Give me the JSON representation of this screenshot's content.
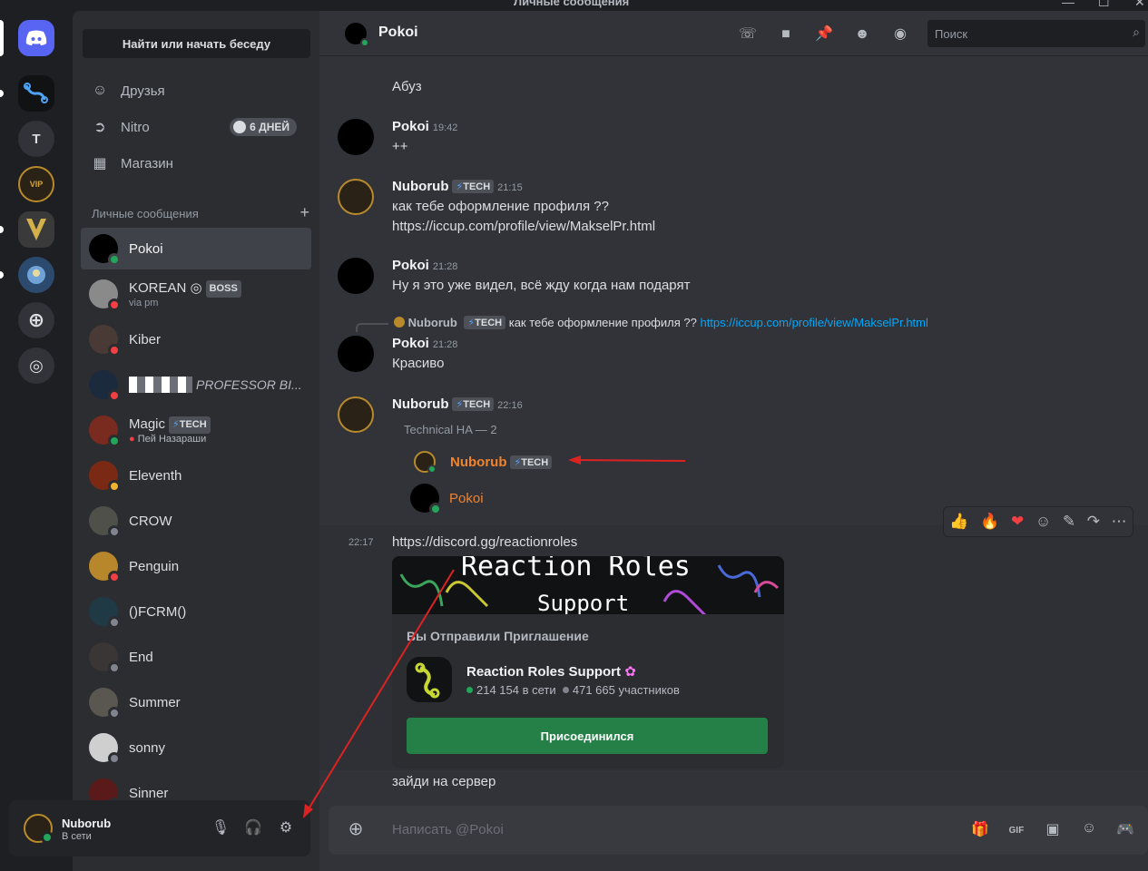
{
  "window": {
    "title": "Личные сообщения"
  },
  "rail": {
    "servers": [
      "T"
    ]
  },
  "sidebar": {
    "search_label": "Найти или начать беседу",
    "nav": [
      {
        "label": "Друзья",
        "icon": "friends-icon"
      },
      {
        "label": "Nitro",
        "icon": "nitro-icon",
        "badge": "6 ДНЕЙ"
      },
      {
        "label": "Магазин",
        "icon": "shop-icon"
      }
    ],
    "dm_header": "Личные сообщения",
    "dms": [
      {
        "name": "Pokoi",
        "status": "online",
        "selected": true
      },
      {
        "name": "KOREAN ◎",
        "tag": "BOSS",
        "sub": "via pm",
        "status": "dnd"
      },
      {
        "name": "Kiber",
        "status": "dnd"
      },
      {
        "name": "PROFESSOR BI...",
        "status": "dnd"
      },
      {
        "name": "Magic",
        "tag": "TECH",
        "sub": "Пей Назараши",
        "status": "online"
      },
      {
        "name": "Eleventh",
        "status": "idle"
      },
      {
        "name": "CROW",
        "status": "offline"
      },
      {
        "name": "Penguin",
        "status": "dnd"
      },
      {
        "name": "()FCRM()",
        "status": "offline"
      },
      {
        "name": "End",
        "status": "offline"
      },
      {
        "name": "Summer",
        "status": "offline"
      },
      {
        "name": "sonny",
        "status": "offline"
      },
      {
        "name": "Sinner",
        "status": "offline"
      }
    ]
  },
  "user": {
    "name": "Nuborub",
    "status": "В сети"
  },
  "chat": {
    "recipient": "Pokoi",
    "search_placeholder": "Поиск",
    "composer_placeholder": "Написать @Pokoi",
    "messages": {
      "m0_text": "Абуз",
      "m1": {
        "author": "Pokoi",
        "time": "19:42",
        "text": "++"
      },
      "m2": {
        "author": "Nuborub",
        "tag": "TECH",
        "time": "21:15",
        "text": "как тебе оформление профиля ??",
        "link": "https://iccup.com/profile/view/MakselPr.html"
      },
      "m3": {
        "author": "Pokoi",
        "time": "21:28",
        "text": "Ну я это уже видел, всё жду когда нам подарят"
      },
      "reply": {
        "author": "Nuborub",
        "tag": "TECH",
        "text": "как тебе оформление профиля ??",
        "link": "https://iccup.com/profile/view/MakselPr.html"
      },
      "m4": {
        "author": "Pokoi",
        "time": "21:28",
        "text": "Красиво"
      },
      "m5": {
        "author": "Nuborub",
        "tag": "TECH",
        "time": "22:16",
        "thread_title": "Technical HA — 2",
        "p1": "Nuborub",
        "p1_tag": "TECH",
        "p2": "Pokoi"
      },
      "m6": {
        "time": "22:17",
        "link": "https://discord.gg/reactionroles"
      },
      "m7_text": "зайди на сервер"
    },
    "embed": {
      "banner_line1": "Reaction Roles",
      "banner_line2": "Support",
      "invite_title": "Вы Отправили Приглашение",
      "server_name": "Reaction Roles Support",
      "online": "214 154 в сети",
      "members": "471 665 участников",
      "join_label": "Присоединился"
    },
    "reactions": [
      "👍",
      "🔥",
      "❤"
    ]
  },
  "colors": {
    "accent": "#5865f2",
    "online": "#23a55a",
    "dnd": "#f23f43",
    "link": "#00a8fc",
    "join": "#248046"
  }
}
